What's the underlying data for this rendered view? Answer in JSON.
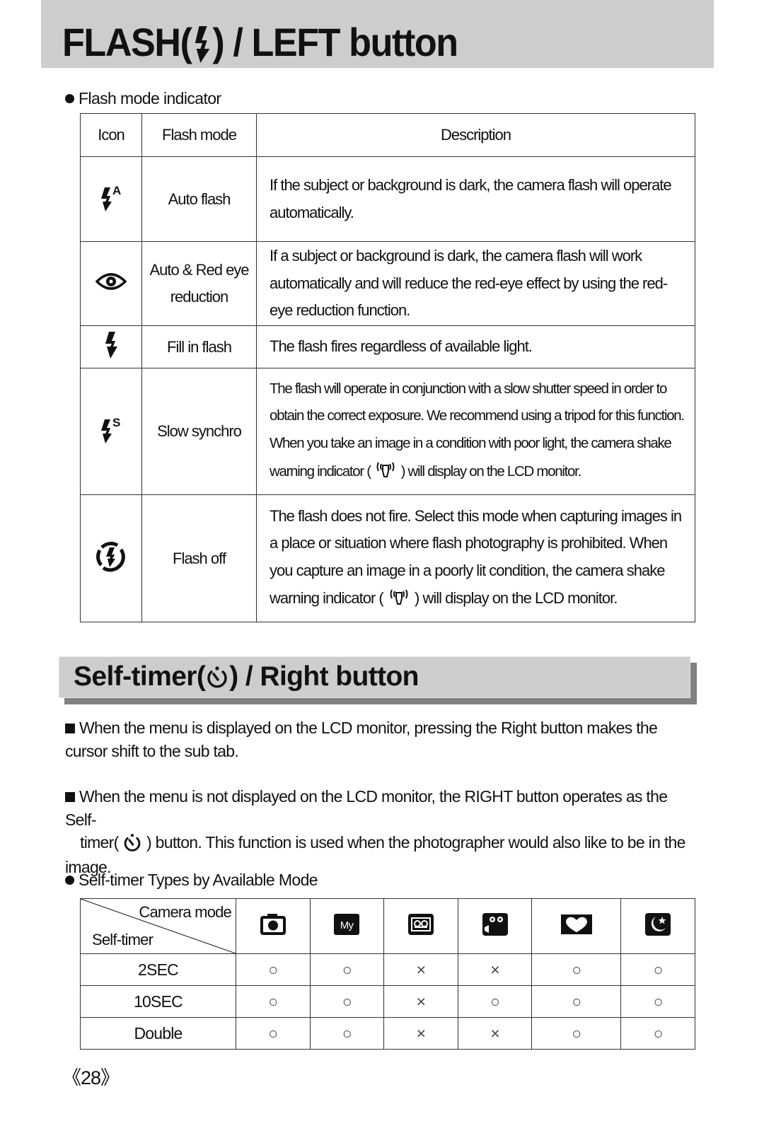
{
  "header": {
    "title_prefix": "FLASH(",
    "title_icon": "flash-icon",
    "title_suffix": ") / LEFT button"
  },
  "flash_section": {
    "bullet": "Flash mode indicator",
    "table": {
      "columns": [
        "Icon",
        "Flash mode",
        "Description"
      ],
      "rows": [
        {
          "icon": "auto-flash-icon",
          "mode": "Auto flash",
          "description": "If the subject or background is dark, the camera flash will operate automatically."
        },
        {
          "icon": "red-eye-icon",
          "mode": "Auto & Red eye reduction",
          "description": "If a subject or background is dark, the camera flash will work automatically and will reduce the red-eye effect by using the red-eye reduction function."
        },
        {
          "icon": "fill-flash-icon",
          "mode": "Fill in flash",
          "description": "The flash fires regardless of available light."
        },
        {
          "icon": "slow-synchro-icon",
          "mode": "Slow synchro",
          "description_before": "The flash will operate in conjunction with a slow shutter speed in order to obtain the correct exposure. We recommend using a tripod for this function. When you take an image in a condition with poor light, the camera shake warning indicator (",
          "description_icon": "camera-shake-icon",
          "description_after": ") will display on the LCD monitor."
        },
        {
          "icon": "flash-off-icon",
          "mode": "Flash off",
          "description_before": "The flash does not fire. Select this mode when capturing images in a place or situation where flash photography is prohibited. When you capture an image in a poorly lit condition, the camera shake warning indicator (",
          "description_icon": "camera-shake-icon",
          "description_after": ") will display on the LCD monitor."
        }
      ]
    }
  },
  "selftimer_section": {
    "heading_prefix": "Self-timer(",
    "heading_icon": "self-timer-icon",
    "heading_suffix": ") / Right button",
    "paragraph1": "When the menu is displayed on the LCD monitor, pressing the Right button makes the cursor shift to the sub tab.",
    "paragraph2_line1": "When the menu is not displayed on the LCD monitor, the RIGHT button operates as the Self-",
    "paragraph2_before": "timer(",
    "paragraph2_after": ") button. This function is used when the photographer would also like to be in the image.",
    "bullet": "Self-timer Types by Available Mode",
    "table": {
      "corner_top": "Camera mode",
      "corner_bottom": "Self-timer",
      "mode_icons": [
        "camera-auto-icon",
        "my-mode-icon",
        "voice-recording-icon",
        "movie-clip-icon",
        "portrait-heart-icon",
        "night-scene-icon"
      ],
      "my_label": "My",
      "rows": [
        {
          "label": "2SEC",
          "values": [
            "○",
            "○",
            "×",
            "×",
            "○",
            "○"
          ]
        },
        {
          "label": "10SEC",
          "values": [
            "○",
            "○",
            "×",
            "○",
            "○",
            "○"
          ]
        },
        {
          "label": "Double",
          "values": [
            "○",
            "○",
            "×",
            "×",
            "○",
            "○"
          ]
        }
      ]
    }
  },
  "footer": {
    "page_number": "《28》"
  }
}
